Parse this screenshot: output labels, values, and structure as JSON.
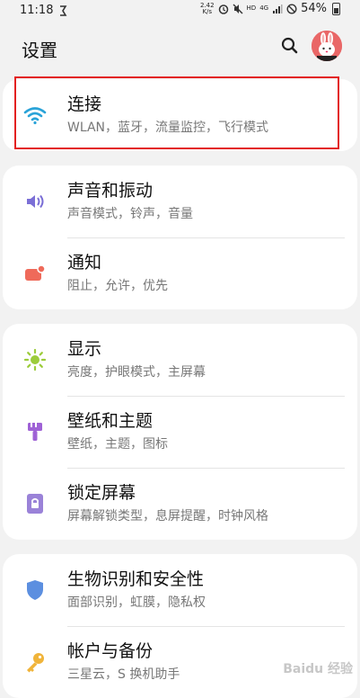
{
  "status_bar": {
    "time": "11:18",
    "net_speed_value": "2.42",
    "net_speed_unit": "K/s",
    "hd": "HD",
    "lte": "4G",
    "battery": "54%"
  },
  "header": {
    "title": "设置",
    "search_icon": "search-icon",
    "avatar_icon": "bunny-avatar"
  },
  "groups": [
    {
      "items": [
        {
          "icon": "wifi-icon",
          "color": "#2aa3d8",
          "title": "连接",
          "subtitle": "WLAN，蓝牙，流量监控，飞行模式"
        }
      ]
    },
    {
      "items": [
        {
          "icon": "speaker-icon",
          "color": "#7b6fd6",
          "title": "声音和振动",
          "subtitle": "声音模式，铃声，音量"
        },
        {
          "icon": "notification-icon",
          "color": "#ef6a5a",
          "title": "通知",
          "subtitle": "阻止，允许，优先"
        }
      ]
    },
    {
      "items": [
        {
          "icon": "sun-icon",
          "color": "#9ccc3b",
          "title": "显示",
          "subtitle": "亮度，护眼模式，主屏幕"
        },
        {
          "icon": "brush-icon",
          "color": "#9f62d6",
          "title": "壁纸和主题",
          "subtitle": "壁纸，主题，图标"
        },
        {
          "icon": "lock-icon",
          "color": "#9a82d8",
          "title": "锁定屏幕",
          "subtitle": "屏幕解锁类型，息屏提醒，时钟风格"
        }
      ]
    },
    {
      "items": [
        {
          "icon": "shield-icon",
          "color": "#5c8fe0",
          "title": "生物识别和安全性",
          "subtitle": "面部识别，虹膜，隐私权"
        },
        {
          "icon": "key-icon",
          "color": "#f0b43a",
          "title": "帐户与备份",
          "subtitle": "三星云，S 换机助手"
        }
      ]
    }
  ],
  "watermark": "Baidu 经验"
}
